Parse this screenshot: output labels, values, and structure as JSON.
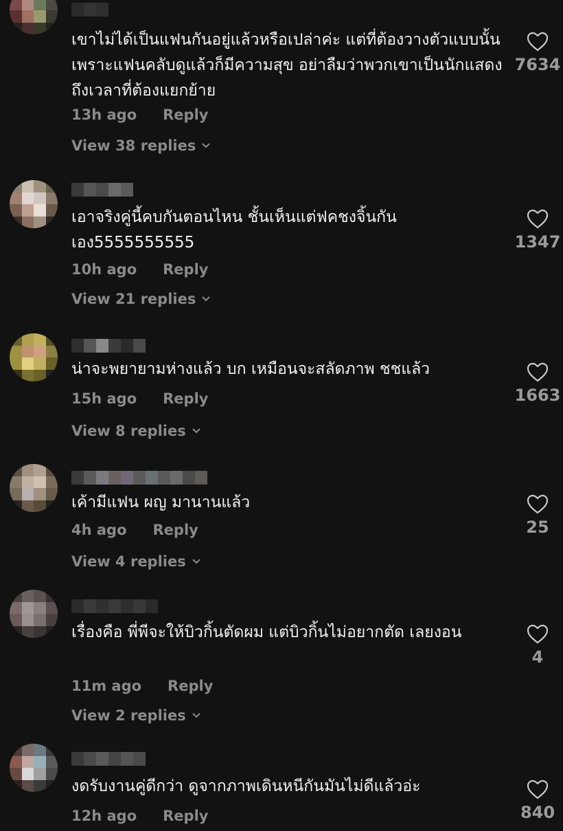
{
  "comments": [
    {
      "text": "เขาไม่ได้เป็นแฟนกันอยู่แล้วหรือเปล่าค่ะ แต่ที่ต้องวางตัวแบบนั้นเพราะแฟนคลับดูแล้วก็มีความสุข อย่าลืมว่าพวกเขาเป็นนักแสดง ถึงเวลาที่ต้องแยกย้าย",
      "time": "13h ago",
      "reply": "Reply",
      "view_replies": "View 38 replies",
      "likes": "7634"
    },
    {
      "text": "เอาจริงคู่นี้คบกันตอนไหน ชั้นเห็นแต่ฟคชงจิ้นกันเอง5555555555",
      "time": "10h ago",
      "reply": "Reply",
      "view_replies": "View 21 replies",
      "likes": "1347"
    },
    {
      "text": "น่าจะพยายามห่างแล้ว บก เหมือนจะสลัดภาพ ชชแล้ว",
      "time": "15h ago",
      "reply": "Reply",
      "view_replies": "View 8 replies",
      "likes": "1663"
    },
    {
      "text": "เค้ามีแฟน ผญ มานานแล้ว",
      "time": "4h ago",
      "reply": "Reply",
      "view_replies": "View 4 replies",
      "likes": "25"
    },
    {
      "text": "เรื่องคือ พี่พีจะให้บิวกิ้นตัดผม แต่บิวกิ้นไม่อยากตัด เลยงอน",
      "time": "11m ago",
      "reply": "Reply",
      "view_replies": "View 2 replies",
      "likes": "4"
    },
    {
      "text": "งดรับงานคู่ดีกว่า ดูจากภาพเดินหนีกันมันไม่ดีแล้วอ่ะ",
      "time": "12h ago",
      "reply": "Reply",
      "view_replies": "",
      "likes": "840"
    }
  ],
  "icons": {
    "like": "heart-outline-icon",
    "expand": "chevron-down-icon"
  },
  "colors": {
    "background": "#121212",
    "text": "#f0f0f0",
    "muted": "#8a8a8a"
  }
}
